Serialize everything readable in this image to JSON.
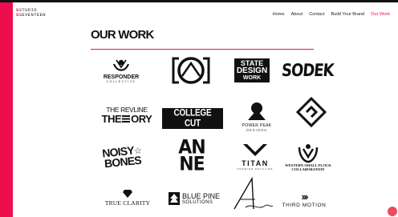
{
  "brand": {
    "line1": "STUDIO",
    "line2": "SEVENTEEN",
    "accent": "#ec0e4e"
  },
  "nav": {
    "items": [
      "Home",
      "About",
      "Contact",
      "Build Your Brand",
      "Our Work"
    ],
    "active": "Our Work"
  },
  "heading": "OUR WORK",
  "logos": {
    "responder": {
      "name": "RESPONDER",
      "sub": "COLLECTIVE"
    },
    "dsr_state": {
      "line1": "STATE",
      "line2": "DESIGN",
      "line3": "WORK"
    },
    "sodek": {
      "name": "SODEK"
    },
    "revline": {
      "line1": "THE REVLINE",
      "line2": "THE",
      "line3": "ORY"
    },
    "college_cut": {
      "name": "COLLEGE CUT"
    },
    "power_peak": {
      "line1": "POWER PEAK",
      "line2": "DESIGNS"
    },
    "noisy_bones": {
      "line1": "NOISY",
      "line2": "BONES"
    },
    "anne": {
      "line1": "AN",
      "line2": "NE"
    },
    "titan": {
      "name": "TITAN",
      "sub": "PREMIER DETAILER"
    },
    "western": {
      "line1": "WESTERN SMALL FLOCK",
      "line2": "COLLABORATION"
    },
    "true_clarity": {
      "name": "TRUE CLARITY"
    },
    "blue_pine": {
      "line1": "BLUE PINE",
      "line2": "SOLUTIONS"
    },
    "third_motion": {
      "name": "THIRD MOTION"
    }
  }
}
